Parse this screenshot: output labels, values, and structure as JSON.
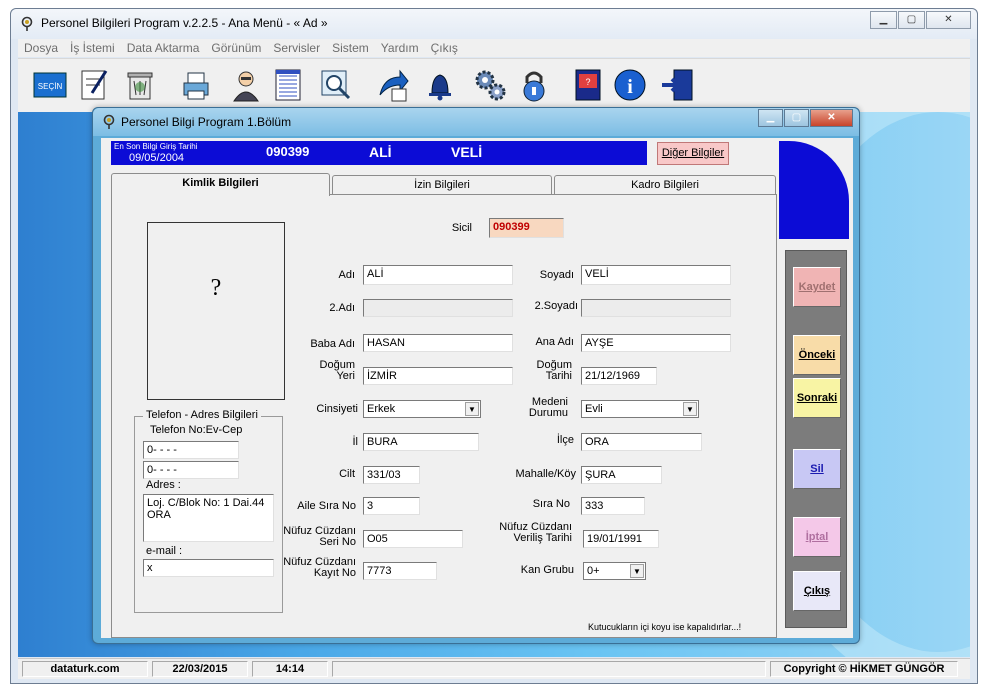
{
  "app": {
    "title": "Personel Bilgileri Program v.2.2.5  - Ana Menü -  « Ad »",
    "menu": [
      "Dosya",
      "İş İstemi",
      "Data Aktarma",
      "Görünüm",
      "Servisler",
      "Sistem",
      "Yardım",
      "Çıkış"
    ],
    "toolbar_icons": [
      "secin-icon",
      "edit-icon",
      "trash-icon",
      "printer-icon",
      "user-icon",
      "document-icon",
      "search-icon",
      "export-icon",
      "bell-icon",
      "settings-icon",
      "lock-icon",
      "book-icon",
      "info-icon",
      "exit-icon"
    ]
  },
  "statusbar": {
    "site": "dataturk.com",
    "date": "22/03/2015",
    "time": "14:14",
    "copyright": "Copyright © HİKMET GÜNGÖR"
  },
  "window": {
    "title": "Personel Bilgi Program 1.Bölüm",
    "infobar": {
      "last_entry_label": "En Son Bilgi Giriş Tarihi",
      "last_entry_date": "09/05/2004",
      "sicil": "090399",
      "ad": "ALİ",
      "soyad": "VELİ"
    },
    "diger_button": "Diğer Bilgiler",
    "tabs": [
      "Kimlik Bilgileri",
      "İzin Bilgileri",
      "Kadro Bilgileri"
    ],
    "photo_placeholder": "?",
    "contact": {
      "title": "Telefon - Adres Bilgileri",
      "phone_label": "Telefon No:Ev-Cep",
      "phone_home": "0-   -   -   -",
      "phone_mobile": "0-   -   -   -",
      "address_label": "Adres :",
      "address_line1": "Loj. C/Blok No: 1 Dai.44",
      "address_line2": "ORA",
      "email_label": "e-mail :",
      "email": "x"
    },
    "form": {
      "sicil_label": "Sicil",
      "sicil": "090399",
      "adi_label": "Adı",
      "adi": "ALİ",
      "soyadi_label": "Soyadı",
      "soyadi": "VELİ",
      "adi2_label": "2.Adı",
      "adi2": "",
      "soyadi2_label": "2.Soyadı",
      "soyadi2": "",
      "baba_label": "Baba Adı",
      "baba": "HASAN",
      "ana_label": "Ana Adı",
      "ana": "AYŞE",
      "dogum_yeri_label1": "Doğum",
      "dogum_yeri_label2": "Yeri",
      "dogum_yeri": "İZMİR",
      "dogum_tarihi_label1": "Doğum",
      "dogum_tarihi_label2": "Tarihi",
      "dogum_tarihi": "21/12/1969",
      "cinsiyet_label": "Cinsiyeti",
      "cinsiyet": "Erkek",
      "medeni_label1": "Medeni",
      "medeni_label2": "Durumu",
      "medeni": "Evli",
      "il_label": "İl",
      "il": "BURA",
      "ilce_label": "İlçe",
      "ilce": "ORA",
      "cilt_label": "Cilt",
      "cilt": "331/03",
      "mahalle_label": "Mahalle/Köy",
      "mahalle": "ŞURA",
      "aile_label": "Aile Sıra No",
      "aile": "3",
      "sira_label": "Sıra No",
      "sira": "333",
      "nc_seri_label1": "Nüfuz Cüzdanı",
      "nc_seri_label2": "Seri No",
      "nc_seri": "O05",
      "nc_verilis_label1": "Nüfuz Cüzdanı",
      "nc_verilis_label2": "Veriliş Tarihi",
      "nc_verilis": "19/01/1991",
      "nc_kayit_label1": "Nüfuz Cüzdanı",
      "nc_kayit_label2": "Kayıt No",
      "nc_kayit": "7773",
      "kan_label": "Kan Grubu",
      "kan": "0+"
    },
    "note": "Kutucukların içi koyu ise kapalıdırlar...!",
    "actions": {
      "kaydet": "Kaydet",
      "onceki": "Önceki",
      "sonraki": "Sonraki",
      "sil": "Sil",
      "iptal": "İptal",
      "cikis": "Çıkış"
    },
    "colors": {
      "infobar": "#0c0cd6",
      "kaydet": "#f0b4b4",
      "onceki": "#f8dca8",
      "sonraki": "#f8f4a4",
      "sil": "#c8c8f4",
      "iptal": "#f4c8e8",
      "cikis": "#e8e8f8"
    }
  }
}
